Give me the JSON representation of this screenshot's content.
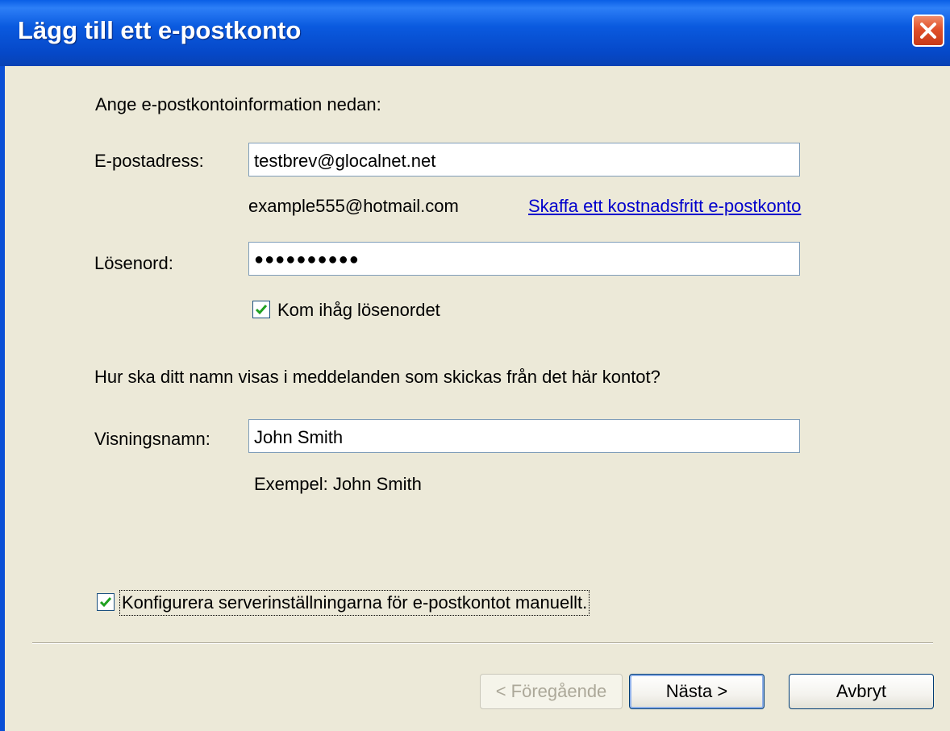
{
  "window": {
    "title": "Lägg till ett e-postkonto"
  },
  "intro_text": "Ange e-postkontoinformation nedan:",
  "email": {
    "label": "E-postadress:",
    "value": "testbrev@glocalnet.net",
    "example": "example555@hotmail.com",
    "link": "Skaffa ett kostnadsfritt e-postkonto"
  },
  "password": {
    "label": "Lösenord:",
    "masked_value": "●●●●●●●●●●",
    "remember_label": "Kom ihåg lösenordet",
    "remember_checked": true
  },
  "display_name": {
    "question": "Hur ska ditt namn visas i meddelanden som skickas från det här kontot?",
    "label": "Visningsnamn:",
    "value": "John Smith",
    "example": "Exempel: John Smith"
  },
  "manual_config": {
    "label": "Konfigurera serverinställningarna för e-postkontot manuellt.",
    "checked": true
  },
  "buttons": {
    "back": "< Föregående",
    "next": "Nästa >",
    "cancel": "Avbryt"
  },
  "icons": {
    "close": "close-icon",
    "check": "checkmark-icon"
  },
  "colors": {
    "titlebar": "#0a5adf",
    "close_button": "#e0502a",
    "dialog_bg": "#ece9d8",
    "link": "#0000cc",
    "checkmark": "#21a121"
  }
}
